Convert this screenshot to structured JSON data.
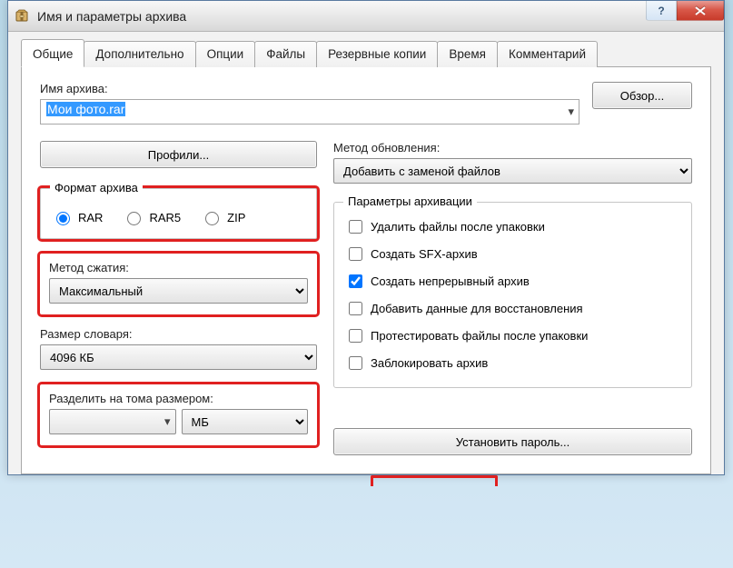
{
  "window": {
    "title": "Имя и параметры архива"
  },
  "tabs": [
    {
      "label": "Общие"
    },
    {
      "label": "Дополнительно"
    },
    {
      "label": "Опции"
    },
    {
      "label": "Файлы"
    },
    {
      "label": "Резервные копии"
    },
    {
      "label": "Время"
    },
    {
      "label": "Комментарий"
    }
  ],
  "archive": {
    "name_label": "Имя архива:",
    "name_value": "Мои фото.rar",
    "browse_btn": "Обзор..."
  },
  "profiles_btn": "Профили...",
  "update": {
    "label": "Метод обновления:",
    "value": "Добавить с заменой файлов"
  },
  "format": {
    "group_title": "Формат архива",
    "options": [
      "RAR",
      "RAR5",
      "ZIP"
    ],
    "selected": "RAR"
  },
  "compression": {
    "label": "Метод сжатия:",
    "value": "Максимальный"
  },
  "dict": {
    "label": "Размер словаря:",
    "value": "4096 КБ"
  },
  "split": {
    "label": "Разделить на тома размером:",
    "value": "",
    "unit": "МБ"
  },
  "params": {
    "group_title": "Параметры архивации",
    "items": [
      {
        "label": "Удалить файлы после упаковки",
        "checked": false
      },
      {
        "label": "Создать SFX-архив",
        "checked": false
      },
      {
        "label": "Создать непрерывный архив",
        "checked": true
      },
      {
        "label": "Добавить данные для восстановления",
        "checked": false
      },
      {
        "label": "Протестировать файлы после упаковки",
        "checked": false
      },
      {
        "label": "Заблокировать архив",
        "checked": false
      }
    ]
  },
  "password_btn": "Установить пароль..."
}
